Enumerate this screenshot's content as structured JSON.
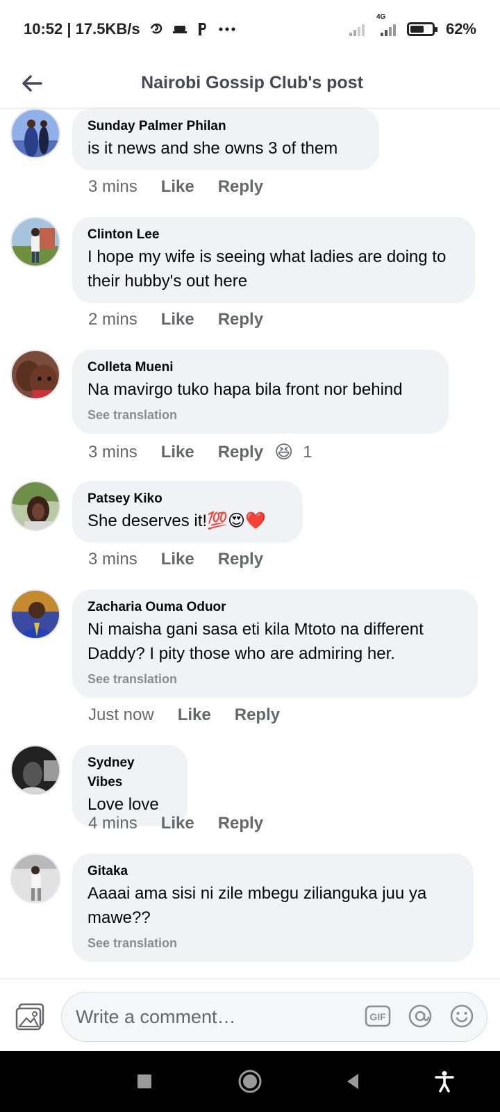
{
  "status_bar": {
    "time_speed": "10:52 | 17.5KB/s",
    "network_label": "4G",
    "battery_percent": "62%",
    "battery_level": 0.62
  },
  "header": {
    "title": "Nairobi Gossip Club's post"
  },
  "comments": [
    {
      "name": "Sunday Palmer Philan",
      "text": "is it news and she owns 3 of them",
      "time": "3 mins",
      "like": "Like",
      "reply": "Reply"
    },
    {
      "name": "Clinton Lee",
      "text": "I hope my wife is seeing what ladies are doing to their hubby's out here",
      "time": "2 mins",
      "like": "Like",
      "reply": "Reply"
    },
    {
      "name": "Colleta Mueni",
      "text": "Na mavirgo tuko hapa bila front nor behind",
      "see_translation": "See translation",
      "time": "3 mins",
      "like": "Like",
      "reply": "Reply",
      "reaction_count": "1"
    },
    {
      "name": "Patsey Kiko",
      "text": "She deserves it!💯😍❤️",
      "time": "3 mins",
      "like": "Like",
      "reply": "Reply"
    },
    {
      "name": "Zacharia Ouma Oduor",
      "text": "Ni maisha gani sasa eti kila Mtoto na different Daddy? I pity those who are admiring her.",
      "see_translation": "See translation",
      "time": "Just now",
      "like": "Like",
      "reply": "Reply"
    },
    {
      "name": "Sydney Vibes",
      "text": "Love love",
      "time": "4 mins",
      "like": "Like",
      "reply": "Reply"
    },
    {
      "name": "Gitaka",
      "text": "Aaaai ama sisi ni zile mbegu zilianguka juu ya mawe??",
      "see_translation": "See translation"
    }
  ],
  "composer": {
    "placeholder": "Write a comment…",
    "gif_label": "GIF"
  }
}
